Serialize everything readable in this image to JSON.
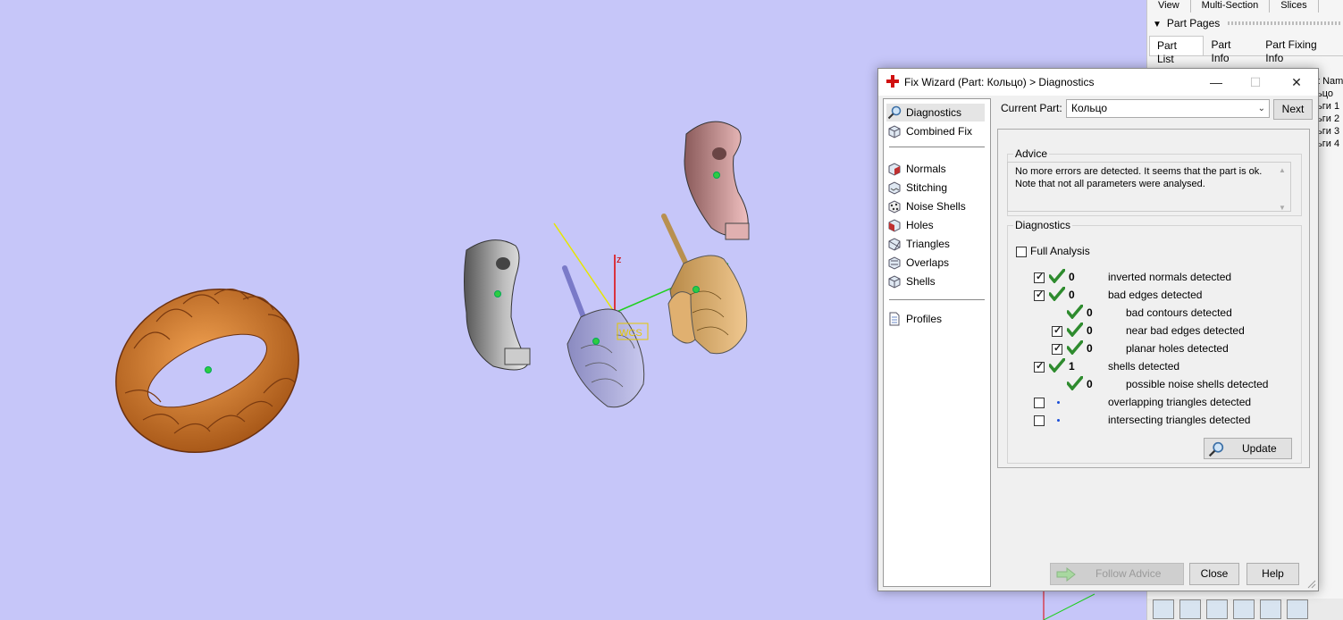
{
  "viewport": {
    "axis_label_z": "z",
    "wcs_label": "WCS"
  },
  "right_panel": {
    "tabs": [
      "View",
      "Multi-Section",
      "Slices"
    ],
    "header": "Part Pages",
    "subtabs": [
      "Part List",
      "Part Info",
      "Part Fixing Info"
    ],
    "column_items": [
      "t Nam",
      "ьцо",
      "ьги 1",
      "ьги 2",
      "ьги 3",
      "ьги 4"
    ]
  },
  "dialog": {
    "title": "Fix Wizard (Part: Кольцо) > Diagnostics",
    "nav_top": [
      {
        "label": "Diagnostics",
        "icon": "magnifier-icon",
        "selected": true
      },
      {
        "label": "Combined Fix",
        "icon": "cube-icon"
      }
    ],
    "nav_middle": [
      {
        "label": "Normals",
        "icon": "normals-cube-icon"
      },
      {
        "label": "Stitching",
        "icon": "stitching-cube-icon"
      },
      {
        "label": "Noise Shells",
        "icon": "noise-shells-icon"
      },
      {
        "label": "Holes",
        "icon": "holes-cube-icon"
      },
      {
        "label": "Triangles",
        "icon": "triangles-cube-icon"
      },
      {
        "label": "Overlaps",
        "icon": "overlaps-cube-icon"
      },
      {
        "label": "Shells",
        "icon": "shells-cube-icon"
      }
    ],
    "nav_bottom": [
      {
        "label": "Profiles",
        "icon": "document-icon"
      }
    ],
    "current_part_label": "Current Part:",
    "current_part_value": "Кольцо",
    "next_label": "Next",
    "advice_title": "Advice",
    "advice_text": "No more errors are detected. It seems that the part is ok. Note that not all parameters were analysed.",
    "diagnostics_title": "Diagnostics",
    "full_analysis_label": "Full Analysis",
    "full_analysis_checked": false,
    "rows": [
      {
        "checkbox": true,
        "status": "ok",
        "count": "0",
        "text": "inverted normals detected"
      },
      {
        "checkbox": true,
        "status": "ok",
        "count": "0",
        "text": "bad edges detected"
      },
      {
        "checkbox": null,
        "status": "ok",
        "count": "0",
        "text": "bad contours detected"
      },
      {
        "checkbox": true,
        "status": "ok",
        "count": "0",
        "text": "near bad edges detected"
      },
      {
        "checkbox": true,
        "status": "ok",
        "count": "0",
        "text": "planar holes detected"
      },
      {
        "checkbox": true,
        "status": "ok",
        "count": "1",
        "text": "shells detected"
      },
      {
        "checkbox": null,
        "status": "ok",
        "count": "0",
        "text": "possible noise shells detected"
      },
      {
        "checkbox": false,
        "status": "none",
        "count": "",
        "text": "overlapping triangles detected"
      },
      {
        "checkbox": false,
        "status": "none",
        "count": "",
        "text": "intersecting triangles detected"
      }
    ],
    "update_label": "Update",
    "follow_advice_label": "Follow Advice",
    "close_label": "Close",
    "help_label": "Help"
  },
  "colors": {
    "viewport_bg": "#c6c6f9",
    "check_green": "#2e8b2e",
    "ring_orange": "#d9822b"
  }
}
